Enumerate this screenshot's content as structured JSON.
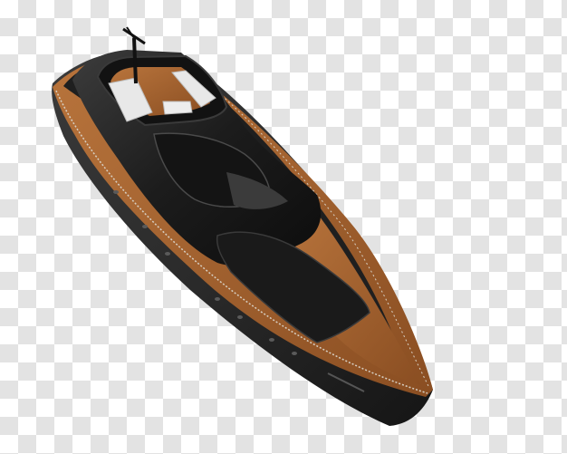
{
  "image": {
    "subject": "yacht",
    "background": "transparency-checkerboard",
    "colors": {
      "checker_light": "#ffffff",
      "checker_dark": "#e3e3e3",
      "hull": "#2b2b2b",
      "hull_shadow": "#1a1a1a",
      "deck_wood": "#9a5a2a",
      "deck_wood_light": "#b8743c",
      "superstructure": "#1c1c1c",
      "glass_highlight": "#4a4a4a",
      "seat_cushion": "#e8e8e8",
      "rail": "#d7cfc3"
    }
  }
}
